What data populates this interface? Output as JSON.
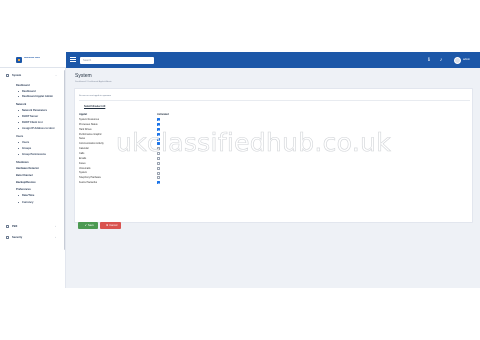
{
  "topbar": {
    "logo_text": "Nocturnal Labs",
    "search_placeholder": "Search",
    "admin_label": "admin"
  },
  "sidebar": {
    "items": [
      {
        "label": "System",
        "level": 0,
        "chevron": "⌄"
      },
      {
        "label": "Dashboard",
        "level": 1
      },
      {
        "label": "Dashboard",
        "level": 2
      },
      {
        "label": "Dashboard Applet Admin",
        "level": 2
      },
      {
        "label": "Network",
        "level": 1
      },
      {
        "label": "Network Parameters",
        "level": 2
      },
      {
        "label": "DHCP Server",
        "level": 2
      },
      {
        "label": "DHCP Client List",
        "level": 2
      },
      {
        "label": "Assign IP Address to Host",
        "level": 2
      },
      {
        "label": "Users",
        "level": 1
      },
      {
        "label": "Users",
        "level": 2
      },
      {
        "label": "Groups",
        "level": 2
      },
      {
        "label": "Group Permissions",
        "level": 2
      },
      {
        "label": "Shutdown",
        "level": 1
      },
      {
        "label": "Hardware Detector",
        "level": 1
      },
      {
        "label": "Beta Channel",
        "level": 1
      },
      {
        "label": "Backup/Restore",
        "level": 1
      },
      {
        "label": "Preferences",
        "level": 1
      },
      {
        "label": "Date/Time",
        "level": 2
      },
      {
        "label": "Currency",
        "level": 2
      },
      {
        "label": "PBX",
        "level": 0,
        "chevron": "›"
      },
      {
        "label": "Security",
        "level": 0,
        "chevron": "›"
      }
    ]
  },
  "page": {
    "title": "System",
    "breadcrumb": "Dashboard  /  Dashboard Applet Admin",
    "note": "Se ven en next apple in aproxmo",
    "select_all": "Select/Unselect All",
    "col_applet": "Applet",
    "col_activated": "Activated"
  },
  "applets": [
    {
      "label": "System Resources",
      "on": true
    },
    {
      "label": "Processes Status",
      "on": true
    },
    {
      "label": "Hard Drives",
      "on": true
    },
    {
      "label": "Performance Graphic",
      "on": true
    },
    {
      "label": "News",
      "on": true
    },
    {
      "label": "Communication Activity",
      "on": true
    },
    {
      "label": "Calendar",
      "on": false
    },
    {
      "label": "Calls",
      "on": false
    },
    {
      "label": "Emails",
      "on": false
    },
    {
      "label": "Faxes",
      "on": false
    },
    {
      "label": "Voicemails",
      "on": false
    },
    {
      "label": "System",
      "on": false
    },
    {
      "label": "Telephony Hardware",
      "on": false
    },
    {
      "label": "Kestrel Networks",
      "on": true
    }
  ],
  "buttons": {
    "save": "Save",
    "cancel": "Cancel"
  },
  "watermark": "ukclassifiedhub.co.uk",
  "colors": {
    "topbar": "#1c57a8",
    "checkbox_on": "#1a73e8",
    "save": "#4c9a52",
    "cancel": "#d9534f"
  }
}
